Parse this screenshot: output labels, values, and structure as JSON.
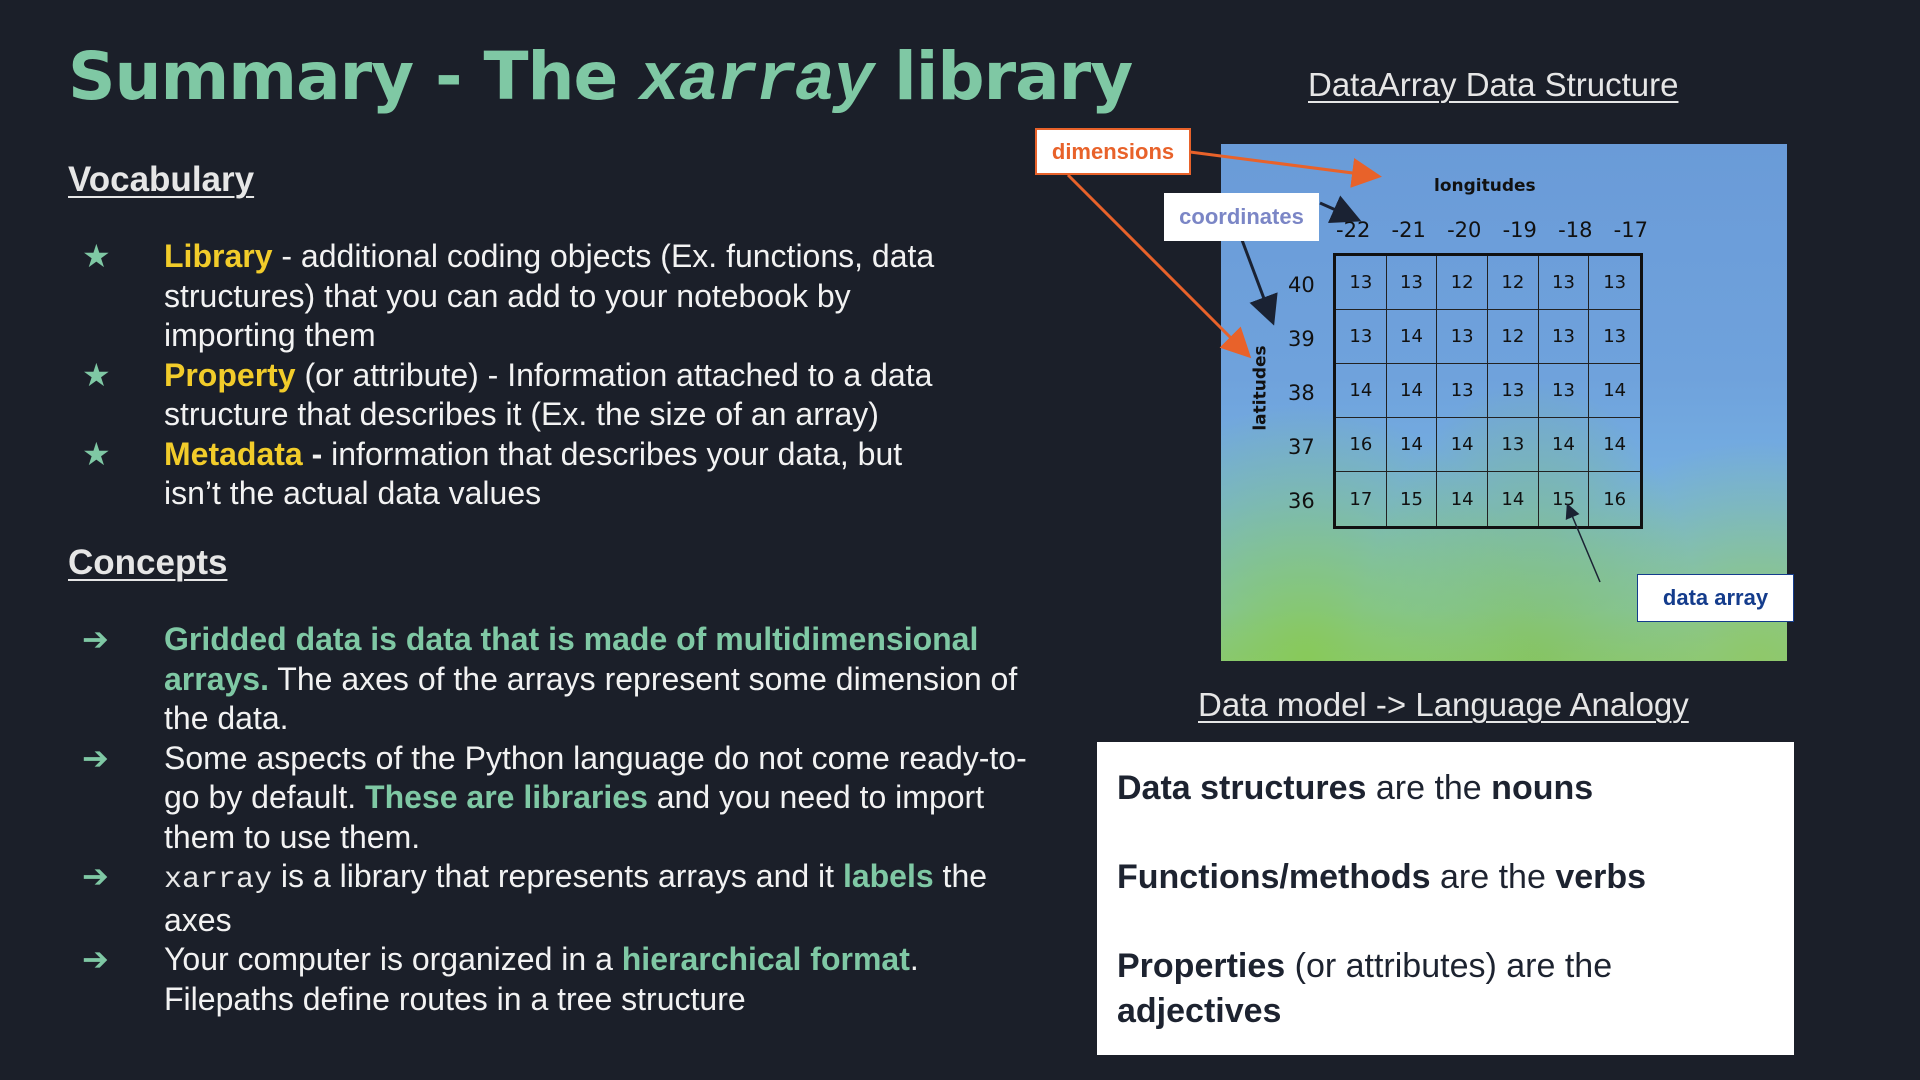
{
  "title": {
    "prefix": "Summary - The ",
    "code": "xarray",
    "suffix": " library"
  },
  "vocabulary": {
    "heading": "Vocabulary",
    "bullet_icon": "star-icon",
    "items": [
      {
        "term": "Library",
        "text": " - additional coding objects (Ex. functions, data structures) that you can add to your notebook by importing them"
      },
      {
        "term": "Property",
        "text": " (or attribute) -  Information attached to a data structure that describes it (Ex. the size of an array)"
      },
      {
        "term": "Metadata",
        "sep": " - ",
        "text": "information that describes your data, but isn’t the actual data values"
      }
    ]
  },
  "concepts": {
    "heading": "Concepts",
    "bullet_icon": "arrow-right-icon",
    "items": [
      {
        "highlight": "Gridded data is data that is made of multidimensional arrays.",
        "text": "  The axes of the arrays represent some dimension of the data."
      },
      {
        "pre": "Some aspects of the Python language do not come ready-to-go by default.  ",
        "highlight": "These are libraries",
        "post": " and you need to import them to use them."
      },
      {
        "code": "xarray",
        "pre": " is a library that represents arrays and it ",
        "highlight": "labels",
        "post": " the axes"
      },
      {
        "pre": "Your computer is organized in a ",
        "highlight": "hierarchical format",
        "post": ". Filepaths define routes in a tree structure"
      }
    ]
  },
  "dataarray": {
    "heading": "DataArray Data Structure",
    "dimension_label": "longitudes",
    "latitude_label": "latitudes",
    "longitudes": [
      "-22",
      "-21",
      "-20",
      "-19",
      "-18",
      "-17"
    ],
    "latitudes": [
      "40",
      "39",
      "38",
      "37",
      "36"
    ],
    "values": [
      [
        "13",
        "13",
        "12",
        "12",
        "13",
        "13"
      ],
      [
        "13",
        "14",
        "13",
        "12",
        "13",
        "13"
      ],
      [
        "14",
        "14",
        "13",
        "13",
        "13",
        "14"
      ],
      [
        "16",
        "14",
        "14",
        "13",
        "14",
        "14"
      ],
      [
        "17",
        "15",
        "14",
        "14",
        "15",
        "16"
      ]
    ],
    "callouts": {
      "dimensions": "dimensions",
      "coordinates": "coordinates",
      "data_array": "data array"
    },
    "colors": {
      "dimensions": "#e8622a",
      "coordinates": "#7b86c6",
      "data_array": "#143c8c"
    }
  },
  "analogy": {
    "heading": "Data model -> Language Analogy",
    "rows": [
      {
        "bold": "Data structures",
        "mid": " are the ",
        "bold2": "nouns"
      },
      {
        "bold": "Functions/methods",
        "mid": " are the ",
        "bold2": "verbs"
      },
      {
        "bold": "Properties",
        "mid": " (or attributes) are the ",
        "bold2": "adjectives"
      }
    ]
  },
  "colors": {
    "background": "#1b1f29",
    "accent_green": "#7fc8a4",
    "term_yellow": "#f2cc2a"
  }
}
